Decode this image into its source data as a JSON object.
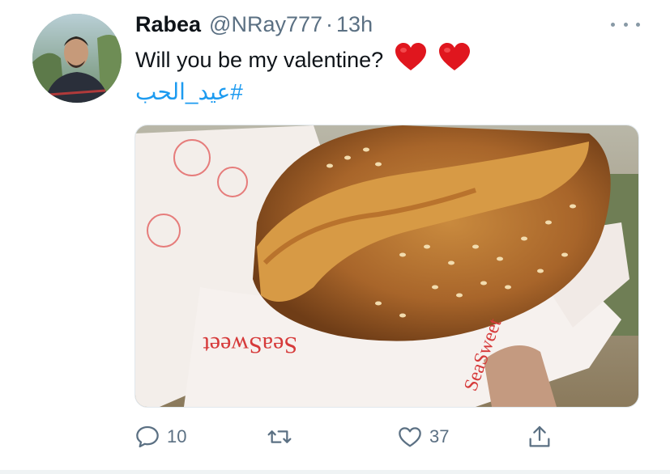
{
  "tweet": {
    "author_name": "Rabea",
    "author_handle": "@NRay777",
    "separator": "·",
    "timestamp": "13h",
    "text": "Will you be my valentine?",
    "hashtag": "#عيد_الحب",
    "heart_emoji": "❤️"
  },
  "actions": {
    "reply_count": "10",
    "retweet_count": "",
    "like_count": "37"
  },
  "media": {
    "wrapper_text": "SeaSweet"
  },
  "colors": {
    "link": "#1d9bf0",
    "secondary_text": "#5b7083",
    "heart_red": "#e0161e"
  },
  "icons": {
    "reply": "speech-bubble-icon",
    "retweet": "retweet-icon",
    "like": "heart-outline-icon",
    "share": "share-upload-icon",
    "more": "more-dots-icon"
  }
}
